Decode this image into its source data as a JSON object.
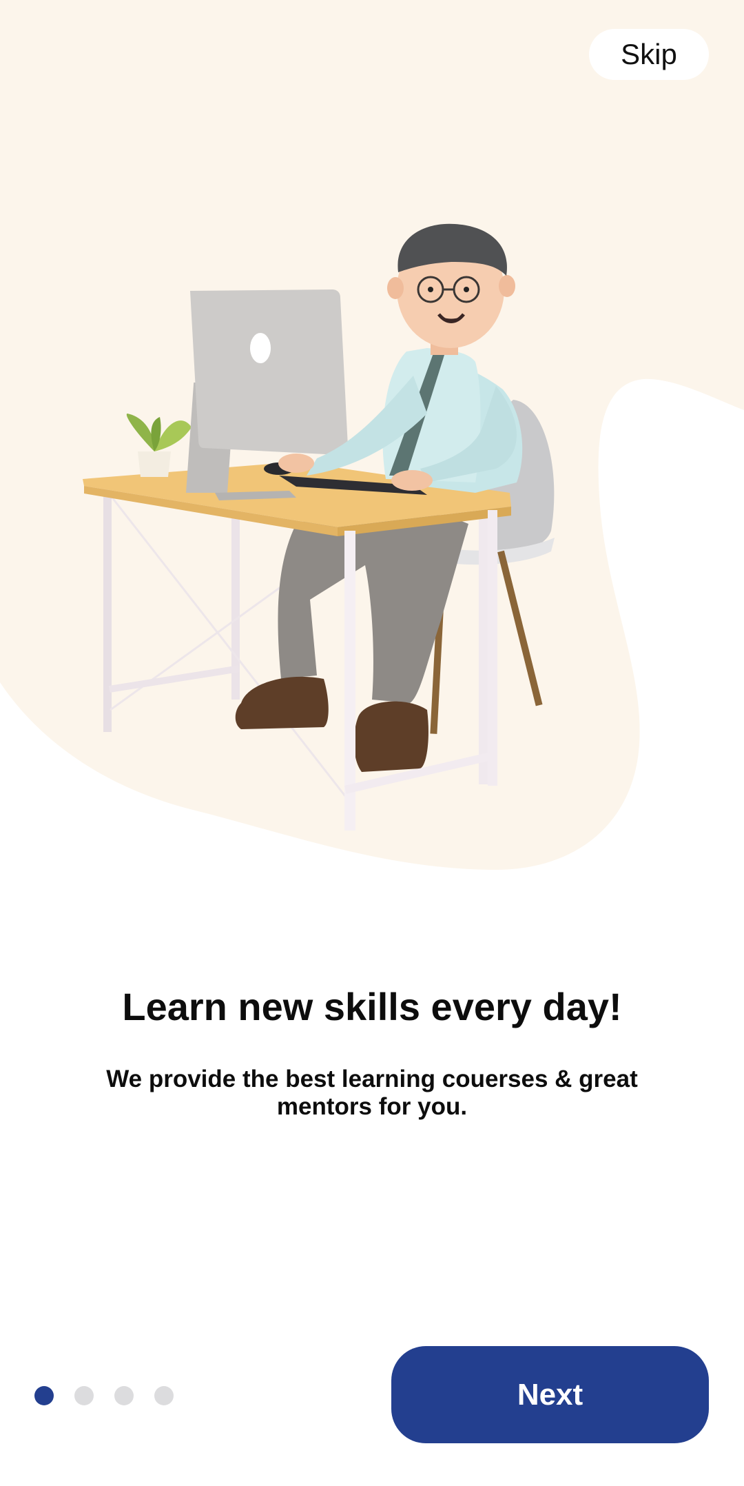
{
  "header": {
    "skip_label": "Skip"
  },
  "onboarding": {
    "headline": "Learn new skills every day!",
    "subtitle": "We provide the best  learning couerses & great mentors for you.",
    "page_count": 4,
    "active_page": 1
  },
  "footer": {
    "next_label": "Next"
  },
  "illustration": {
    "icon": "person-at-desk-illustration"
  },
  "colors": {
    "accent": "#233f8f",
    "background_blob": "#fcf5eb",
    "inactive_dot": "#dcdcde"
  }
}
